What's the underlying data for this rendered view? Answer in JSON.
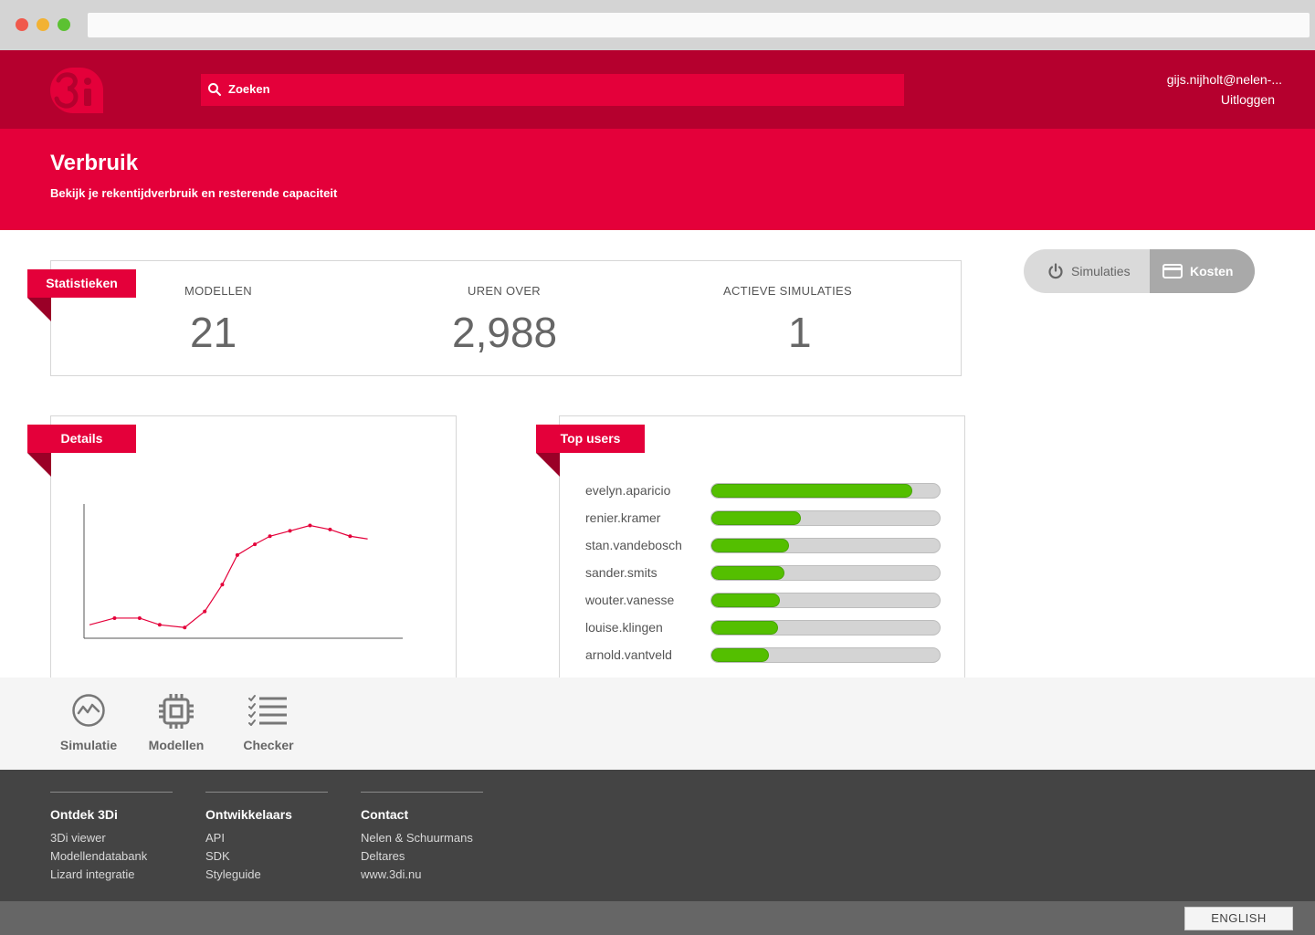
{
  "header": {
    "search_placeholder": "Zoeken",
    "user_email": "gijs.nijholt@nelen-...",
    "logout_label": "Uitloggen"
  },
  "hero": {
    "title": "Verbruik",
    "subtitle": "Bekijk je rekentijdverbruik en resterende capaciteit"
  },
  "stats": {
    "ribbon": "Statistieken",
    "items": [
      {
        "label": "MODELLEN",
        "value": "21"
      },
      {
        "label": "UREN OVER",
        "value": "2,988"
      },
      {
        "label": "ACTIEVE SIMULATIES",
        "value": "1"
      }
    ]
  },
  "toggle": {
    "options": [
      {
        "label": "Simulaties",
        "icon": "power-icon",
        "active": false
      },
      {
        "label": "Kosten",
        "icon": "credit-card-icon",
        "active": true
      }
    ]
  },
  "details": {
    "ribbon": "Details"
  },
  "chart_data": {
    "type": "line",
    "x": [
      0,
      1,
      2,
      3,
      4,
      5,
      6,
      7,
      8,
      9,
      10,
      11,
      12,
      13
    ],
    "series": [
      {
        "values": [
          1.0,
          1.5,
          1.5,
          1.0,
          0.8,
          2.0,
          4.0,
          6.2,
          7.0,
          7.6,
          8.0,
          8.4,
          8.1,
          7.6,
          7.4
        ],
        "color": "#e4003a"
      }
    ],
    "x_points": [
      0,
      1.0,
      2.0,
      2.8,
      3.8,
      4.6,
      5.3,
      5.9,
      6.6,
      7.2,
      8.0,
      8.8,
      9.6,
      10.4,
      11.1
    ],
    "ylim": [
      0,
      10
    ],
    "xlim": [
      0,
      12.5
    ],
    "grid": false,
    "title": "",
    "xlabel": "",
    "ylabel": ""
  },
  "top_users": {
    "ribbon": "Top users",
    "users": [
      {
        "name": "evelyn.aparicio",
        "share": 0.88
      },
      {
        "name": "renier.kramer",
        "share": 0.39
      },
      {
        "name": "stan.vandebosch",
        "share": 0.34
      },
      {
        "name": "sander.smits",
        "share": 0.32
      },
      {
        "name": "wouter.vanesse",
        "share": 0.3
      },
      {
        "name": "louise.klingen",
        "share": 0.29
      },
      {
        "name": "arnold.vantveld",
        "share": 0.25
      }
    ],
    "bar_color": "#54bf00"
  },
  "apps": [
    {
      "label": "Simulatie",
      "icon": "simulation-icon"
    },
    {
      "label": "Modellen",
      "icon": "chip-icon"
    },
    {
      "label": "Checker",
      "icon": "checklist-icon"
    }
  ],
  "footer": {
    "columns": [
      {
        "title": "Ontdek 3Di",
        "links": [
          "3Di viewer",
          "Modellendatabank",
          "Lizard integratie"
        ]
      },
      {
        "title": "Ontwikkelaars",
        "links": [
          "API",
          "SDK",
          "Styleguide"
        ]
      },
      {
        "title": "Contact",
        "links": [
          "Nelen & Schuurmans",
          "Deltares",
          "www.3di.nu"
        ]
      }
    ],
    "language": "ENGLISH"
  },
  "colors": {
    "brand_red": "#e4003a",
    "dark_red": "#b5002e",
    "progress_green": "#54bf00"
  }
}
